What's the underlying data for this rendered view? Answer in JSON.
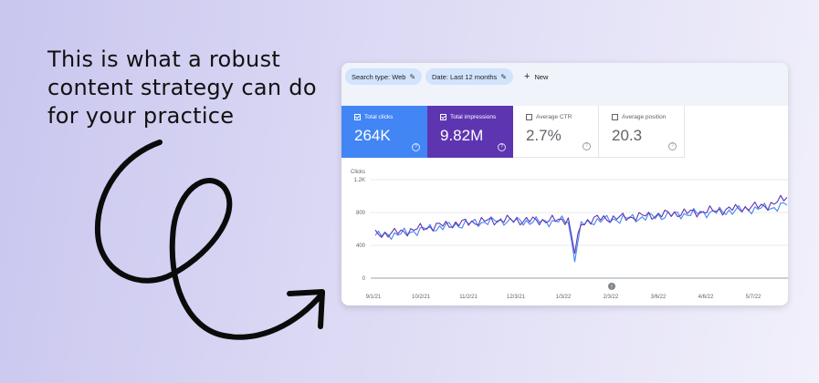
{
  "headline": [
    "This is what a robust",
    "content strategy can do",
    "for your practice"
  ],
  "filters": {
    "search_type": "Search type: Web",
    "date": "Date: Last 12 months",
    "new_label": "New"
  },
  "metrics": [
    {
      "label": "Total clicks",
      "value": "264K",
      "selected": true
    },
    {
      "label": "Total impressions",
      "value": "9.82M",
      "selected": true
    },
    {
      "label": "Average CTR",
      "value": "2.7%",
      "selected": false
    },
    {
      "label": "Average position",
      "value": "20.3",
      "selected": false
    }
  ],
  "colors": {
    "clicks": "#4285f4",
    "impressions": "#5e35b1",
    "filter_chip": "#d2e3fc"
  },
  "chart_data": {
    "type": "line",
    "ylabel": "Clicks",
    "yticks": [
      "1.2K",
      "800",
      "400",
      "0"
    ],
    "ylim": [
      0,
      1200
    ],
    "xticks": [
      "9/1/21",
      "10/2/21",
      "11/2/21",
      "12/3/21",
      "1/3/22",
      "2/3/22",
      "3/6/22",
      "4/6/22",
      "5/7/22"
    ],
    "annotation_marker": "!",
    "series": [
      {
        "name": "Total clicks",
        "color": "#4285f4",
        "anchors": [
          [
            0,
            520
          ],
          [
            8,
            540
          ],
          [
            16,
            600
          ],
          [
            24,
            640
          ],
          [
            32,
            680
          ],
          [
            40,
            700
          ],
          [
            48,
            690
          ],
          [
            56,
            690
          ],
          [
            60,
            700
          ],
          [
            62,
            200
          ],
          [
            64,
            650
          ],
          [
            68,
            700
          ],
          [
            76,
            720
          ],
          [
            84,
            740
          ],
          [
            92,
            770
          ],
          [
            100,
            790
          ],
          [
            108,
            810
          ],
          [
            116,
            840
          ],
          [
            124,
            860
          ],
          [
            128,
            900
          ]
        ]
      },
      {
        "name": "Total impressions",
        "color": "#5e35b1",
        "anchors": [
          [
            0,
            530
          ],
          [
            8,
            560
          ],
          [
            16,
            620
          ],
          [
            24,
            660
          ],
          [
            32,
            690
          ],
          [
            40,
            710
          ],
          [
            48,
            700
          ],
          [
            56,
            705
          ],
          [
            60,
            720
          ],
          [
            62,
            300
          ],
          [
            64,
            670
          ],
          [
            68,
            720
          ],
          [
            76,
            735
          ],
          [
            84,
            760
          ],
          [
            92,
            785
          ],
          [
            100,
            805
          ],
          [
            108,
            830
          ],
          [
            116,
            860
          ],
          [
            124,
            900
          ],
          [
            128,
            1000
          ]
        ]
      }
    ]
  }
}
